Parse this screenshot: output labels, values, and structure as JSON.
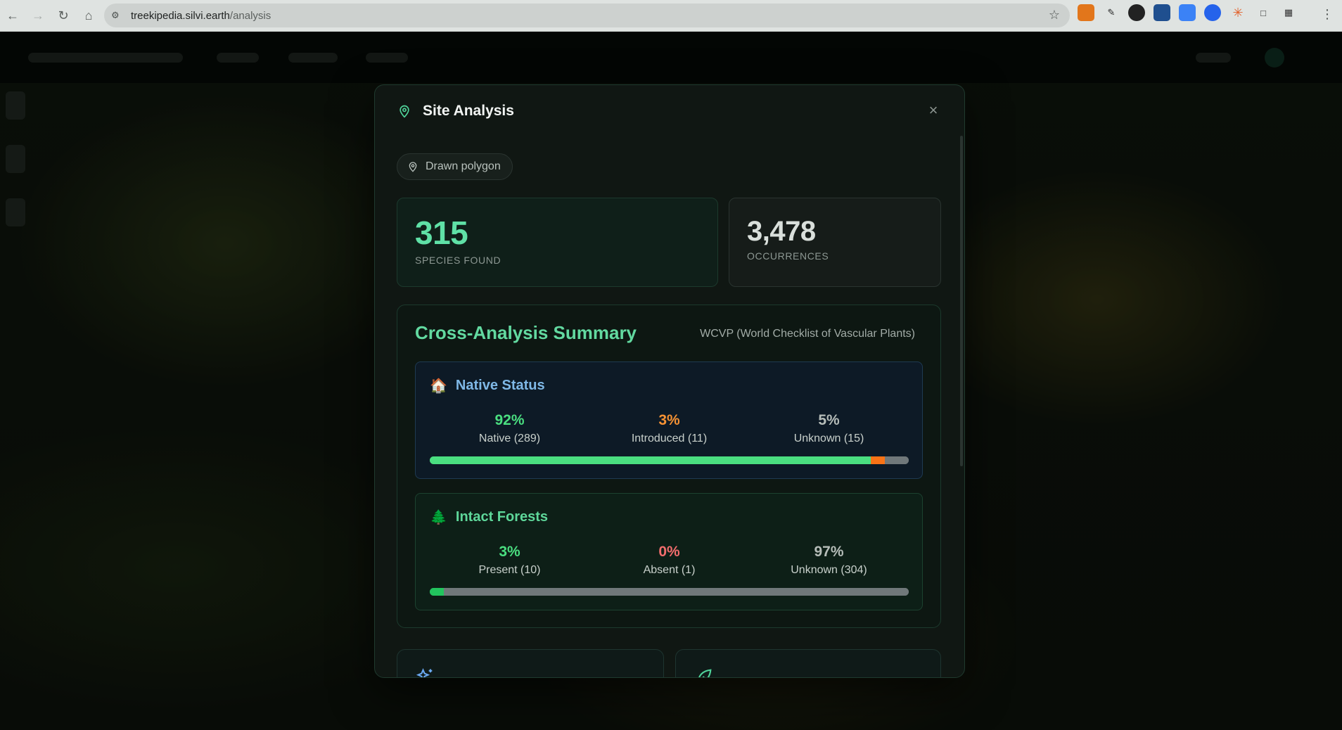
{
  "browser": {
    "url_host": "treekipedia.silvi.earth",
    "url_path": "/analysis"
  },
  "modal": {
    "title": "Site Analysis",
    "close_label": "×",
    "source_chip": "Drawn polygon"
  },
  "stats": {
    "species_count": "315",
    "species_label": "SPECIES FOUND",
    "occurrences_count": "3,478",
    "occurrences_label": "OCCURRENCES"
  },
  "summary": {
    "title": "Cross-Analysis Summary",
    "source": "WCVP (World Checklist of Vascular Plants)",
    "native_status": {
      "title": "Native Status",
      "icon": "house-icon",
      "metrics": [
        {
          "value": "92%",
          "label": "Native (289)",
          "color": "#4ade80",
          "fraction": 0.92
        },
        {
          "value": "3%",
          "label": "Introduced (11)",
          "color": "#f97316",
          "fraction": 0.03
        },
        {
          "value": "5%",
          "label": "Unknown (15)",
          "color": "#70787a",
          "fraction": 0.05
        }
      ]
    },
    "intact_forests": {
      "title": "Intact Forests",
      "icon": "evergreen-tree-icon",
      "metrics": [
        {
          "value": "3%",
          "label": "Present (10)",
          "color": "#22c55e",
          "fraction": 0.03
        },
        {
          "value": "0%",
          "label": "Absent (1)",
          "color": "#ef4444",
          "fraction": 0.0
        },
        {
          "value": "97%",
          "label": "Unknown (304)",
          "color": "#70787a",
          "fraction": 0.97
        }
      ]
    }
  },
  "colors": {
    "accent": "#5fe0a6",
    "modal_bg": "#101713",
    "native_panel_bg": "#0d1a26",
    "forest_panel_bg": "#0d1f17"
  }
}
